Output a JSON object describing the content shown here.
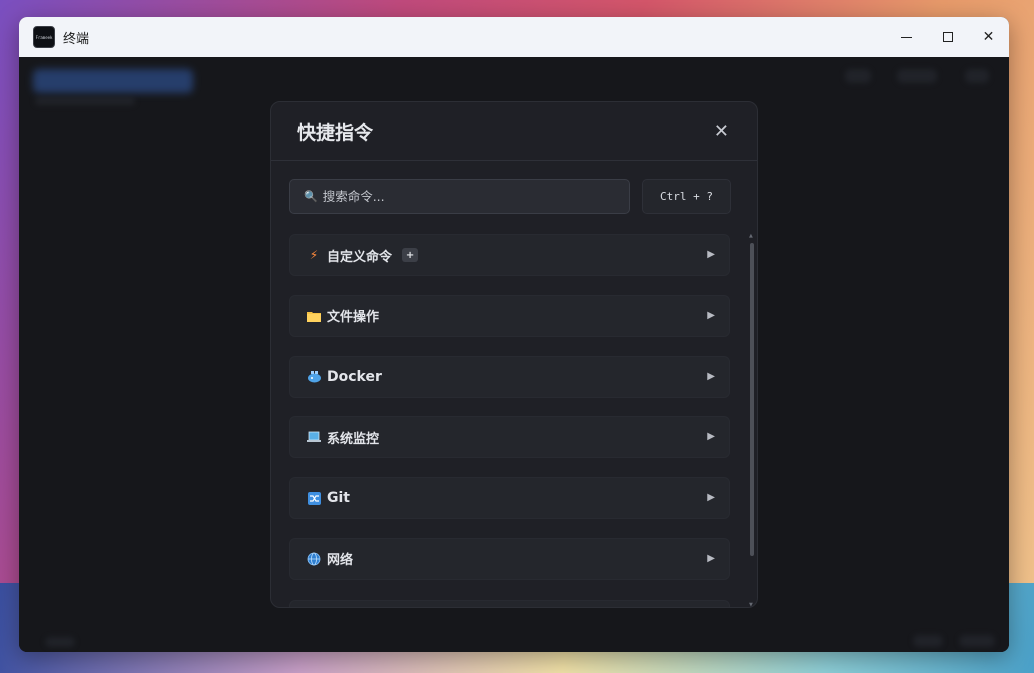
{
  "window": {
    "title": "终端",
    "app_icon_text": "Frameek"
  },
  "modal": {
    "title": "快捷指令",
    "search": {
      "placeholder": "搜索命令..."
    },
    "shortcut": "Ctrl + ?",
    "categories": [
      {
        "icon": "lightning-icon",
        "label": "自定义命令",
        "has_add": true,
        "add_label": "+"
      },
      {
        "icon": "folder-icon",
        "label": "文件操作"
      },
      {
        "icon": "docker-whale-icon",
        "label": "Docker"
      },
      {
        "icon": "laptop-icon",
        "label": "系统监控"
      },
      {
        "icon": "shuffle-icon",
        "label": "Git"
      },
      {
        "icon": "globe-icon",
        "label": "网络"
      }
    ]
  },
  "colors": {
    "modal_bg": "#1f2026",
    "card_bg": "#24262c",
    "text": "#e3e5ea",
    "accent": "#6fb0ff"
  }
}
